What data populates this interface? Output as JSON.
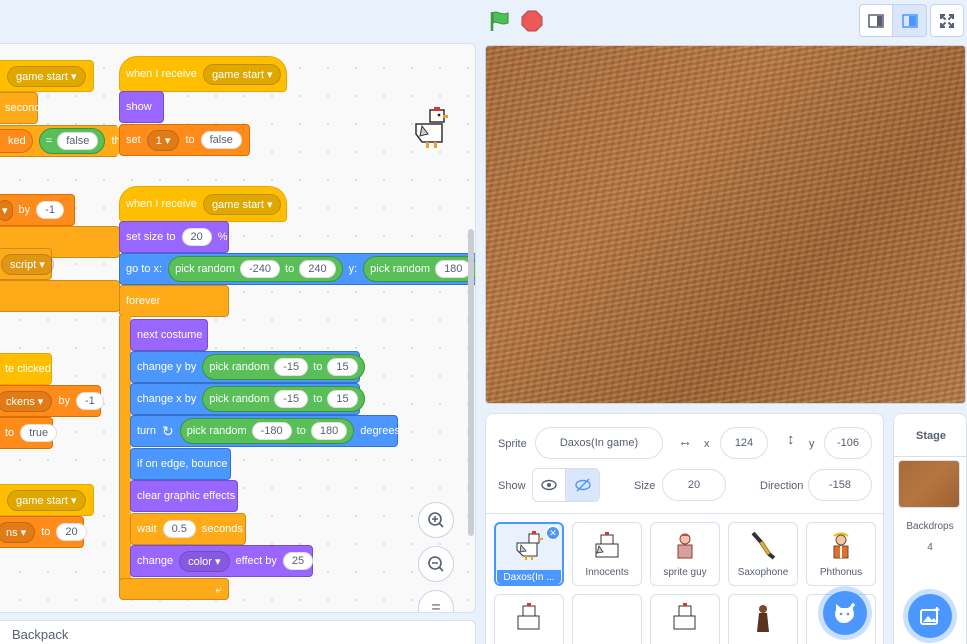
{
  "workspace": {
    "blocks": {
      "b1": "game start",
      "b2": "seconds",
      "b3_label": "ked",
      "b3_eq": "=",
      "b3_val": "false",
      "b3_then": "then",
      "b4_by": "by",
      "b4_val": "-1",
      "b5_menu": "script",
      "b6": "te clicked",
      "b7_menu": "ckens",
      "b7_by": "by",
      "b7_val": "-1",
      "b8_to": "to",
      "b8_val": "true",
      "b9_menu": "game start",
      "b10_menu": "ns",
      "b10_to": "to",
      "b10_val": "20"
    },
    "script1": {
      "hat_label": "when I receive",
      "hat_menu": "game start",
      "show": "show",
      "set": "set",
      "set_var": "1",
      "set_to": "to",
      "set_val": "false"
    },
    "script2": {
      "hat_label": "when I receive",
      "hat_menu": "game start",
      "size_label": "set size to",
      "size_val": "20",
      "size_unit": "%",
      "goto_label": "go to x:",
      "rand": "pick random",
      "x_from": "-240",
      "to": "to",
      "x_to": "240",
      "y_label": "y:",
      "y_from": "180",
      "forever": "forever",
      "next_costume": "next costume",
      "change_y": "change y by",
      "cy_from": "-15",
      "cy_to": "15",
      "change_x": "change x by",
      "cx_from": "-15",
      "cx_to": "15",
      "turn": "turn",
      "t_from": "-180",
      "t_to": "180",
      "degrees": "degrees",
      "bounce": "if on edge, bounce",
      "clear": "clear graphic effects",
      "wait": "wait",
      "wait_val": "0.5",
      "seconds": "seconds",
      "change": "change",
      "effect": "color",
      "effect_by": "effect by",
      "effect_val": "25"
    },
    "zoom_in_icon": "zoom-in-icon",
    "zoom_out_icon": "zoom-out-icon",
    "reset_icon": "=",
    "backpack": "Backpack"
  },
  "sprite_info": {
    "sprite_label": "Sprite",
    "sprite_name": "Daxos(In game)",
    "x_label": "x",
    "x_val": "124",
    "y_label": "y",
    "y_val": "-106",
    "show_label": "Show",
    "size_label": "Size",
    "size_val": "20",
    "direction_label": "Direction",
    "direction_val": "-158"
  },
  "sprites": [
    {
      "name": "Daxos(In ..."
    },
    {
      "name": "Innocents"
    },
    {
      "name": "sprite guy"
    },
    {
      "name": "Saxophone"
    },
    {
      "name": "Phthonus"
    },
    {
      "name": ""
    },
    {
      "name": ""
    },
    {
      "name": ""
    },
    {
      "name": ""
    },
    {
      "name": ""
    }
  ],
  "stage_panel": {
    "title": "Stage",
    "backdrops_label": "Backdrops",
    "backdrops_count": "4"
  },
  "colors": {
    "events": "#ffbf00",
    "looks": "#9966ff",
    "motion": "#4c97ff",
    "control": "#ffab19",
    "operators": "#59c059",
    "variables": "#ff8c1a",
    "accent": "#4c97ff"
  }
}
